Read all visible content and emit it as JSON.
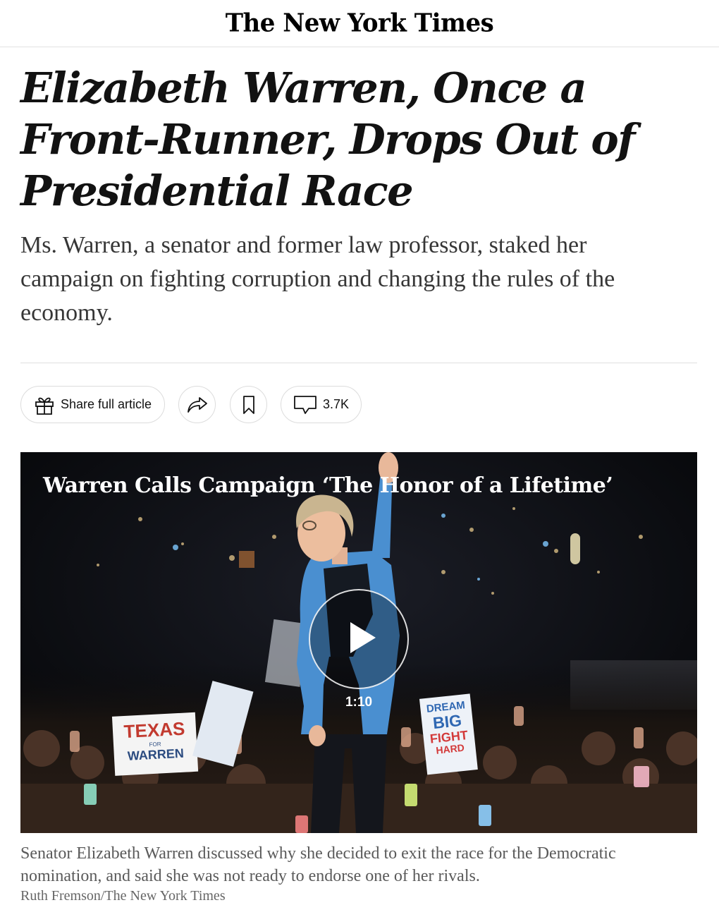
{
  "masthead": {
    "logo_text": "The New York Times"
  },
  "article": {
    "headline": "Elizabeth Warren, Once a Front-Runner, Drops Out of Presidential Race",
    "summary": "Ms. Warren, a senator and former law professor, staked her campaign on fighting corruption and changing the rules of the economy."
  },
  "toolbar": {
    "share_full_label": "Share full article",
    "gift_icon": "gift-icon",
    "share_icon": "share-arrow-icon",
    "save_icon": "bookmark-icon",
    "comment_icon": "comment-icon",
    "comment_count": "3.7K"
  },
  "video": {
    "title": "Warren Calls Campaign ‘The Honor of a Lifetime’",
    "duration": "1:10",
    "play_icon": "play-icon",
    "signs": {
      "left_line1": "TEXAS",
      "left_small": "FOR",
      "left_line2": "WARREN",
      "right_line1": "DREAM",
      "right_line2": "BIG",
      "right_line3": "FIGHT",
      "right_line4": "HARD"
    }
  },
  "caption": {
    "text": "Senator Elizabeth Warren discussed why she decided to exit the race for the Democratic nomination, and said she was not ready to endorse one of her rivals.",
    "credit": "Ruth Fremson/The New York Times"
  },
  "colors": {
    "text": "#121212",
    "dek": "#363636",
    "caption": "#5a5a5a",
    "border": "#dcdcdc",
    "cardigan": "#4a8fd0"
  }
}
